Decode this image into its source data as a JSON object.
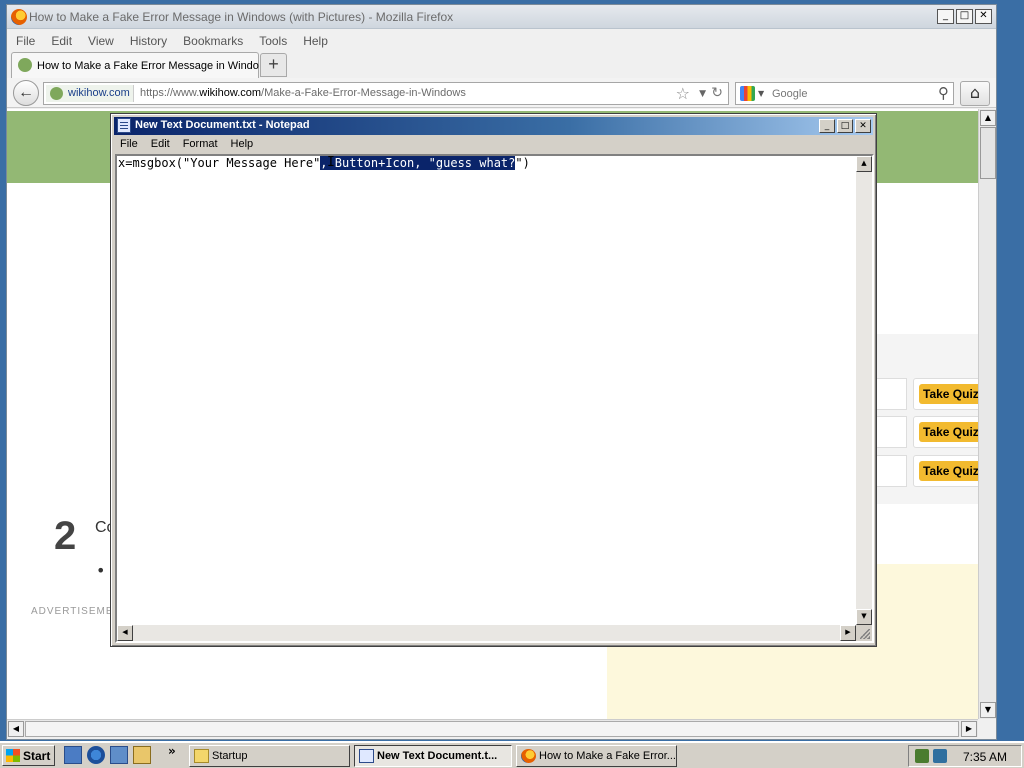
{
  "firefox": {
    "window_title": "How to Make a Fake Error Message in Windows (with Pictures) - Mozilla Firefox",
    "menu": [
      "File",
      "Edit",
      "View",
      "History",
      "Bookmarks",
      "Tools",
      "Help"
    ],
    "tab_title": "How to Make a Fake Error Message in Windo...",
    "new_tab": "+",
    "site_identity": "wikihow.com",
    "url_prefix": "https://www.",
    "url_domain": "wikihow.com",
    "url_path": "/Make-a-Fake-Error-Message-in-Windows",
    "search_placeholder": "Google",
    "window_buttons": {
      "minimize": "_",
      "maximize": "□",
      "close": "✕"
    }
  },
  "page": {
    "quiz_label": "Take Quiz",
    "quiz_rows": 3,
    "step_number": "2",
    "step_text": "Co",
    "bullet": "•",
    "advertisement": "ADVERTISEMENT"
  },
  "notepad": {
    "window_title": "New Text Document.txt - Notepad",
    "menu": [
      "File",
      "Edit",
      "Format",
      "Help"
    ],
    "text_before_selection": "x=msgbox(\"Your Message Here\"",
    "text_selected": ", Button+Icon, \"guess what?",
    "text_after_selection": "\")",
    "cursor_glyph": "I"
  },
  "taskbar": {
    "start_label": "Start",
    "more_indicator": "»",
    "buttons": [
      {
        "label": "Startup",
        "active": false
      },
      {
        "label": "New Text Document.t...",
        "active": true
      },
      {
        "label": "How to Make a Fake Error...",
        "active": false
      }
    ],
    "clock": "7:35 AM"
  },
  "colors": {
    "wikihow_green": "#93b874",
    "quiz_button": "#f2ba2f",
    "selection": "#0a246a",
    "notepad_title_start": "#0a246a",
    "notepad_title_end": "#a6caf0"
  }
}
